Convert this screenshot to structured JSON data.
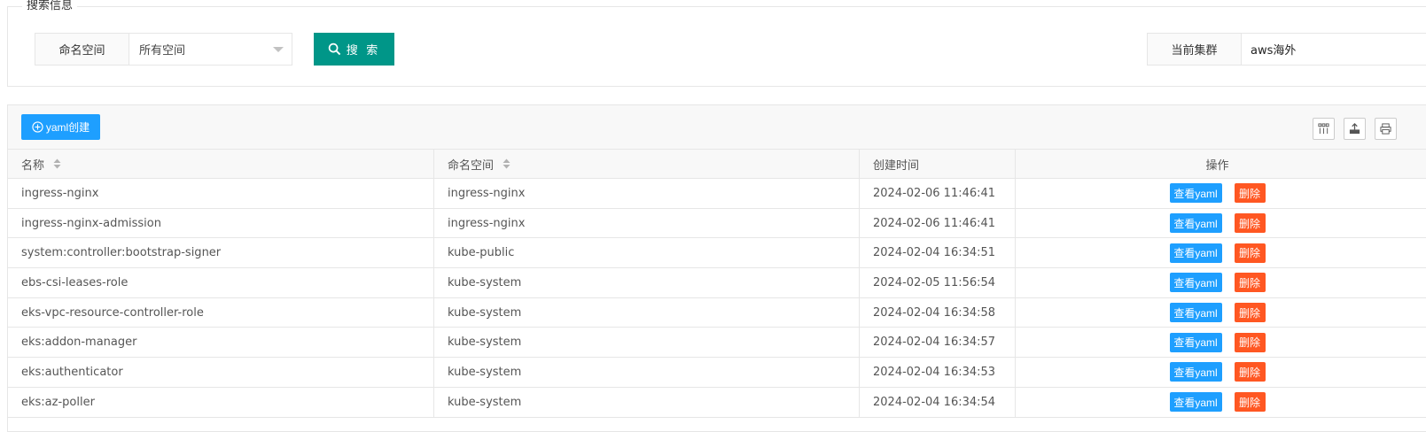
{
  "search": {
    "legend": "搜索信息",
    "namespace_label": "命名空间",
    "namespace_value": "所有空间",
    "search_button": "搜 索",
    "cluster_label": "当前集群",
    "cluster_value": "aws海外"
  },
  "toolbar": {
    "create_button": "yaml创建",
    "icons": [
      "columns-icon",
      "export-icon",
      "print-icon"
    ]
  },
  "table": {
    "columns": [
      "名称",
      "命名空间",
      "创建时间",
      "操作"
    ],
    "view_label": "查看yaml",
    "delete_label": "删除",
    "rows": [
      {
        "name": "ingress-nginx",
        "namespace": "ingress-nginx",
        "created": "2024-02-06 11:46:41",
        "view": "查看yaml",
        "delete": "删除"
      },
      {
        "name": "ingress-nginx-admission",
        "namespace": "ingress-nginx",
        "created": "2024-02-06 11:46:41",
        "view": "查看yaml",
        "delete": "删除"
      },
      {
        "name": "system:controller:bootstrap-signer",
        "namespace": "kube-public",
        "created": "2024-02-04 16:34:51",
        "view": "查看yaml",
        "delete": "删除"
      },
      {
        "name": "ebs-csi-leases-role",
        "namespace": "kube-system",
        "created": "2024-02-05 11:56:54",
        "view": "查看yaml",
        "delete": "删除"
      },
      {
        "name": "eks-vpc-resource-controller-role",
        "namespace": "kube-system",
        "created": "2024-02-04 16:34:58",
        "view": "查看yaml",
        "delete": "删除"
      },
      {
        "name": "eks:addon-manager",
        "namespace": "kube-system",
        "created": "2024-02-04 16:34:57",
        "view": "查看yaml",
        "delete": "删除"
      },
      {
        "name": "eks:authenticator",
        "namespace": "kube-system",
        "created": "2024-02-04 16:34:53",
        "view": "查看yaml",
        "delete": "删除"
      },
      {
        "name": "eks:az-poller",
        "namespace": "kube-system",
        "created": "2024-02-04 16:34:54",
        "view": "查看yaml",
        "delete": "删除"
      }
    ]
  },
  "colors": {
    "primary_teal": "#009688",
    "accent_blue": "#1e9fff",
    "danger_orange": "#ff5722"
  }
}
